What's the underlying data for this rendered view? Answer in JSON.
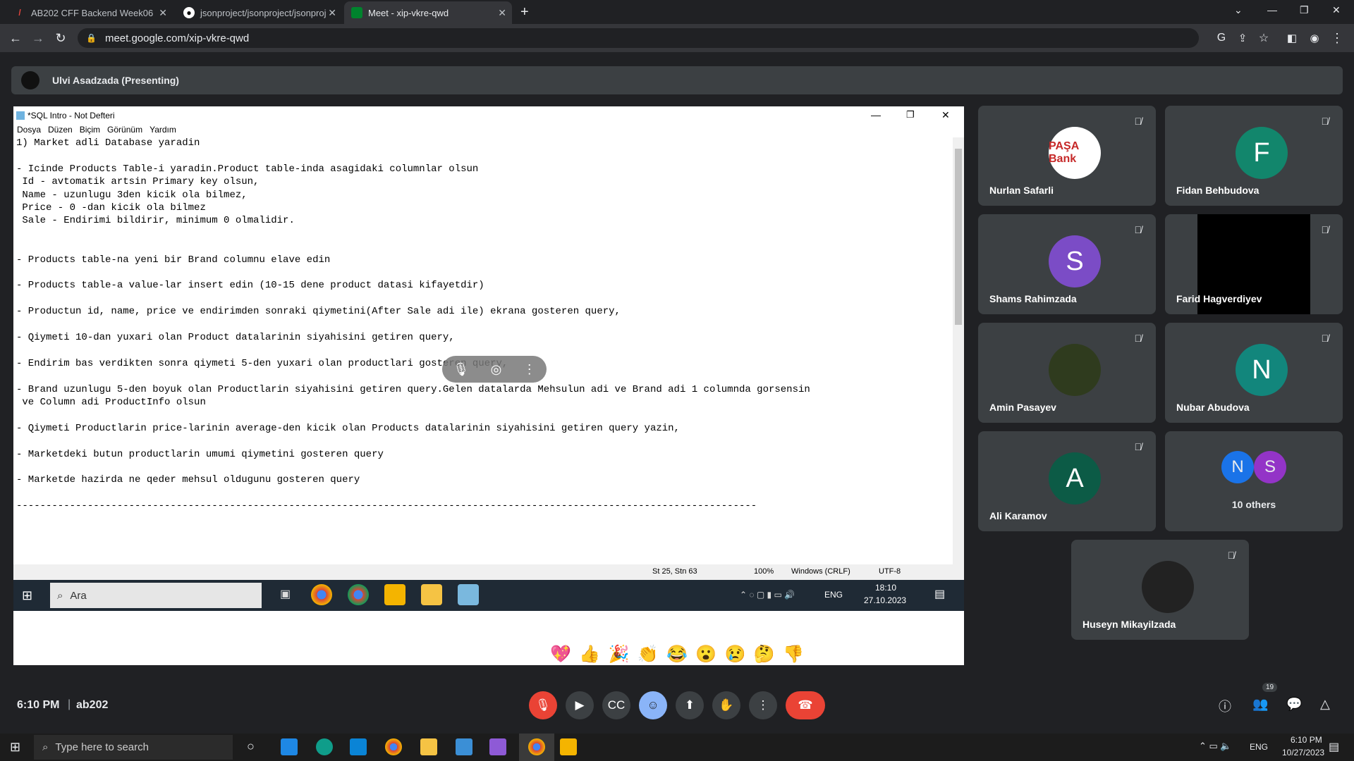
{
  "browser": {
    "tabs": [
      {
        "title": "AB202 CFF Backend Week06",
        "icon": "slash-icon"
      },
      {
        "title": "jsonproject/jsonproject/jsonproj",
        "icon": "github-icon"
      },
      {
        "title": "Meet - xip-vkre-qwd",
        "icon": "meet-icon",
        "active": true
      }
    ],
    "url": "meet.google.com/xip-vkre-qwd"
  },
  "meet": {
    "presenter_label": "Ulvi Asadzada (Presenting)",
    "participants": [
      {
        "name": "Nurlan Safarli",
        "avatar_text": "PAŞA Bank",
        "avatar_color": "#ffffff"
      },
      {
        "name": "Fidan Behbudova",
        "avatar_text": "F",
        "avatar_color": "#12866c"
      },
      {
        "name": "Shams Rahimzada",
        "avatar_text": "S",
        "avatar_color": "#7b4cc6"
      },
      {
        "name": "Farid Hagverdiyev",
        "avatar_text": "",
        "avatar_color": "#000000"
      },
      {
        "name": "Amin Pasayev",
        "avatar_text": "",
        "avatar_color": "#2f3b1e"
      },
      {
        "name": "Nubar Abudova",
        "avatar_text": "N",
        "avatar_color": "#12867c"
      },
      {
        "name": "Ali Karamov",
        "avatar_text": "A",
        "avatar_color": "#0c5b46"
      },
      {
        "name": "Huseyn Mikayilzada",
        "avatar_text": "",
        "avatar_color": "#222222"
      }
    ],
    "others": {
      "label": "10 others",
      "avatars": [
        "N",
        "S"
      ]
    },
    "time": "6:10 PM",
    "meeting_code": "ab202",
    "people_count": "19",
    "reactions": [
      "💖",
      "👍",
      "🎉",
      "👏",
      "😂",
      "😮",
      "😢",
      "🤔",
      "👎"
    ]
  },
  "notepad": {
    "title": "*SQL Intro - Not Defteri",
    "menu": [
      "Dosya",
      "Düzen",
      "Biçim",
      "Görünüm",
      "Yardım"
    ],
    "lines": [
      "1) Market adli Database yaradin",
      "",
      "- Icinde Products Table-i yaradin.Product table-inda asagidaki columnlar olsun",
      " Id - avtomatik artsin Primary key olsun,",
      " Name - uzunlugu 3den kicik ola bilmez,",
      " Price - 0 -dan kicik ola bilmez",
      " Sale - Endirimi bildirir, minimum 0 olmalidir.",
      "",
      "",
      "- Products table-na yeni bir Brand columnu elave edin",
      "",
      "- Products table-a value-lar insert edin (10-15 dene product datasi kifayetdir)",
      "",
      "- Productun id, name, price ve endirimden sonraki qiymetini(After Sale adi ile) ekrana gosteren query,",
      "",
      "- Qiymeti 10-dan yuxari olan Product datalarinin siyahisini getiren query,",
      "",
      "- Endirim bas verdikten sonra qiymeti 5-den yuxari olan productlari gosteren query,",
      "",
      "- Brand uzunlugu 5-den boyuk olan Productlarin siyahisini getiren query.Gelen datalarda Mehsulun adi ve Brand adi 1 columnda gorsensin",
      " ve Column adi ProductInfo olsun",
      "",
      "- Qiymeti Productlarin price-larinin average-den kicik olan Products datalarinin siyahisini getiren query yazin,",
      "",
      "- Marketdeki butun productlarin umumi qiymetini gosteren query",
      "",
      "- Marketde hazirda ne qeder mehsul oldugunu gosteren query",
      "",
      "-----------------------------------------------------------------------------------------------------------------------------"
    ],
    "status": {
      "position": "St 25, Stn 63",
      "zoom": "100%",
      "line_ending": "Windows (CRLF)",
      "encoding": "UTF-8"
    }
  },
  "remote_taskbar": {
    "search_placeholder": "Ara",
    "lang": "ENG",
    "time": "18:10",
    "date": "27.10.2023"
  },
  "os_taskbar": {
    "search_placeholder": "Type here to search",
    "lang": "ENG",
    "time": "6:10 PM",
    "date": "10/27/2023"
  }
}
